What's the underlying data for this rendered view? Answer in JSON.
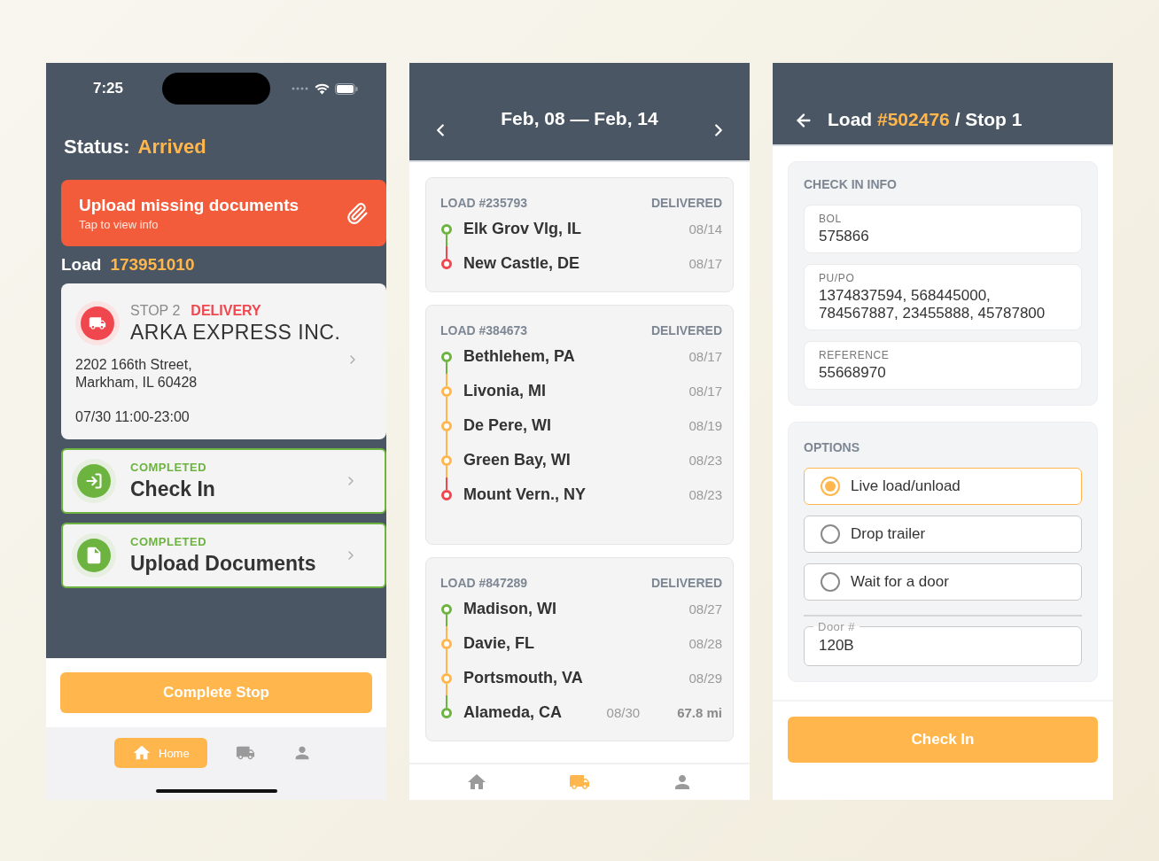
{
  "stop_screen": {
    "status_bar": {
      "time": "7:25"
    },
    "status": {
      "label": "Status:",
      "value": "Arrived"
    },
    "alert": {
      "title": "Upload missing documents",
      "subtitle": "Tap to view info"
    },
    "load": {
      "label": "Load",
      "number": "173951010"
    },
    "stop_card": {
      "stop": "STOP 2",
      "type": "DELIVERY",
      "company": "ARKA EXPRESS INC.",
      "address_lines": [
        "2202 166th Street,",
        "Markham, IL 60428"
      ],
      "window": "07/30 11:00-23:00"
    },
    "tasks": [
      {
        "kind": "check-in",
        "status": "COMPLETED",
        "title": "Check In"
      },
      {
        "kind": "document",
        "status": "COMPLETED",
        "title": "Upload Documents"
      }
    ],
    "complete_button": "Complete Stop",
    "nav": [
      {
        "kind": "home",
        "label": "Home",
        "selected": true
      },
      {
        "kind": "truck",
        "selected": false
      },
      {
        "kind": "person",
        "selected": false
      }
    ]
  },
  "loads_screen": {
    "header": {
      "title": "Feb, 08 — Feb, 14"
    },
    "loads": [
      {
        "number": "LOAD #235793",
        "status": "DELIVERED",
        "stops": [
          {
            "city": "Elk Grov Vlg, IL",
            "date": "08/14",
            "color": "#6db33f"
          },
          {
            "city": "New Castle, DE",
            "date": "08/17",
            "color": "#f0474f"
          }
        ]
      },
      {
        "number": "LOAD #384673",
        "status": "DELIVERED",
        "stops": [
          {
            "city": "Bethlehem, PA",
            "date": "08/17",
            "color": "#6db33f"
          },
          {
            "city": "Livonia, MI",
            "date": "08/17",
            "color": "#ffb74d"
          },
          {
            "city": "De Pere, WI",
            "date": "08/19",
            "color": "#ffb74d"
          },
          {
            "city": "Green Bay, WI",
            "date": "08/23",
            "color": "#ffb74d"
          },
          {
            "city": "Mount Vern., NY",
            "date": "08/23",
            "color": "#f0474f"
          }
        ]
      },
      {
        "number": "LOAD #847289",
        "status": "DELIVERED",
        "stops": [
          {
            "city": "Madison, WI",
            "date": "08/27",
            "color": "#6db33f"
          },
          {
            "city": "Davie, FL",
            "date": "08/28",
            "color": "#ffb74d"
          },
          {
            "city": "Portsmouth, VA",
            "date": "08/29",
            "color": "#ffb74d"
          },
          {
            "city": "Alameda, CA",
            "date": "08/30",
            "distance": "67.8 mi",
            "color": "#6db33f"
          }
        ]
      }
    ],
    "nav": [
      {
        "kind": "home",
        "selected": false
      },
      {
        "kind": "truck",
        "selected": true
      },
      {
        "kind": "person",
        "selected": false
      }
    ]
  },
  "check_in_screen": {
    "header": {
      "prefix": "Load",
      "number": "#502476",
      "suffix": "/ Stop 1"
    },
    "check_in_info": {
      "title": "CHECK IN INFO",
      "fields": [
        {
          "label": "BOL",
          "value": "575866"
        },
        {
          "label": "PU/PO",
          "value": "1374837594, 568445000, 784567887, 23455888, 45787800"
        },
        {
          "label": "REFERENCE",
          "value": "55668970"
        }
      ]
    },
    "options": {
      "title": "OPTIONS",
      "items": [
        {
          "label": "Live load/unload",
          "selected": true
        },
        {
          "label": "Drop trailer",
          "selected": false
        },
        {
          "label": "Wait for a door",
          "selected": false
        }
      ]
    },
    "door_field": {
      "label": "Door #",
      "value": "120B"
    },
    "check_in_button": "Check In"
  }
}
